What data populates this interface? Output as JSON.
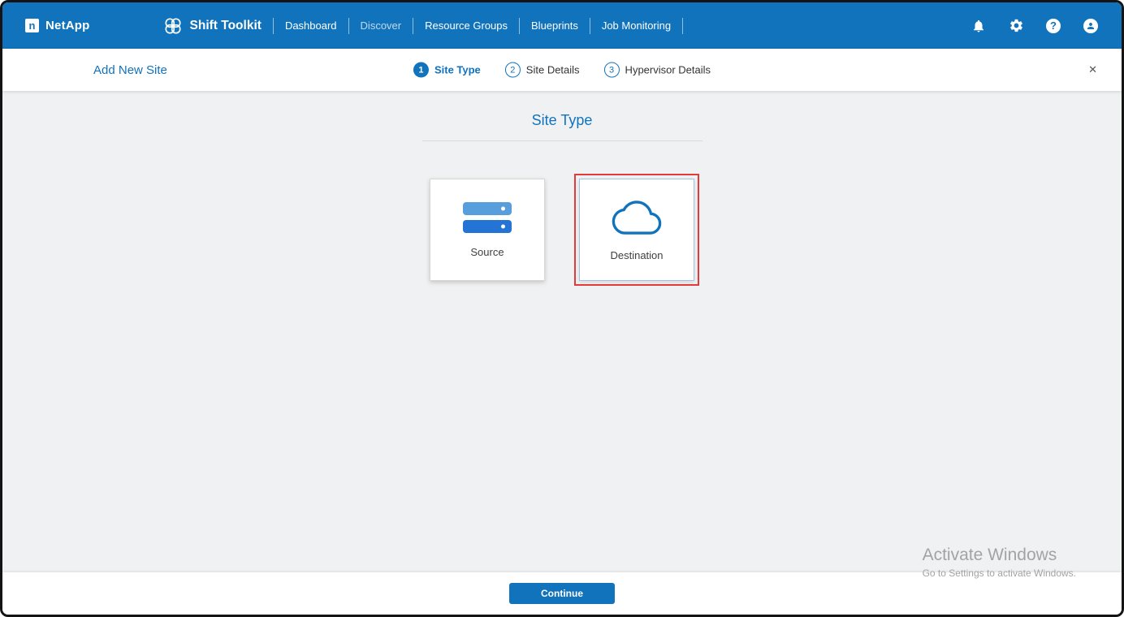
{
  "colors": {
    "nav_blue": "#1173BC",
    "accent_blue": "#1173BC",
    "selection_highlight_red": "#E23B3B",
    "main_background": "#F0F1F2"
  },
  "topnav": {
    "brand": "NetApp",
    "brand_logo_glyph": "n",
    "app_title": "Shift Toolkit",
    "items": [
      {
        "label": "Dashboard"
      },
      {
        "label": "Discover"
      },
      {
        "label": "Resource Groups"
      },
      {
        "label": "Blueprints"
      },
      {
        "label": "Job Monitoring"
      }
    ],
    "right_icons": [
      "notifications-icon",
      "settings-icon",
      "help-icon",
      "account-icon"
    ],
    "help_glyph": "?"
  },
  "wizard": {
    "title": "Add New Site",
    "close_glyph": "✕",
    "steps": [
      {
        "number": "1",
        "label": "Site Type"
      },
      {
        "number": "2",
        "label": "Site Details"
      },
      {
        "number": "3",
        "label": "Hypervisor Details"
      }
    ]
  },
  "main": {
    "section_title": "Site Type",
    "cards": [
      {
        "label": "Source",
        "icon": "server-stack-icon",
        "selected": false
      },
      {
        "label": "Destination",
        "icon": "cloud-icon",
        "selected": true
      }
    ]
  },
  "footer": {
    "continue_label": "Continue"
  },
  "watermark": {
    "line1": "Activate Windows",
    "line2": "Go to Settings to activate Windows."
  }
}
